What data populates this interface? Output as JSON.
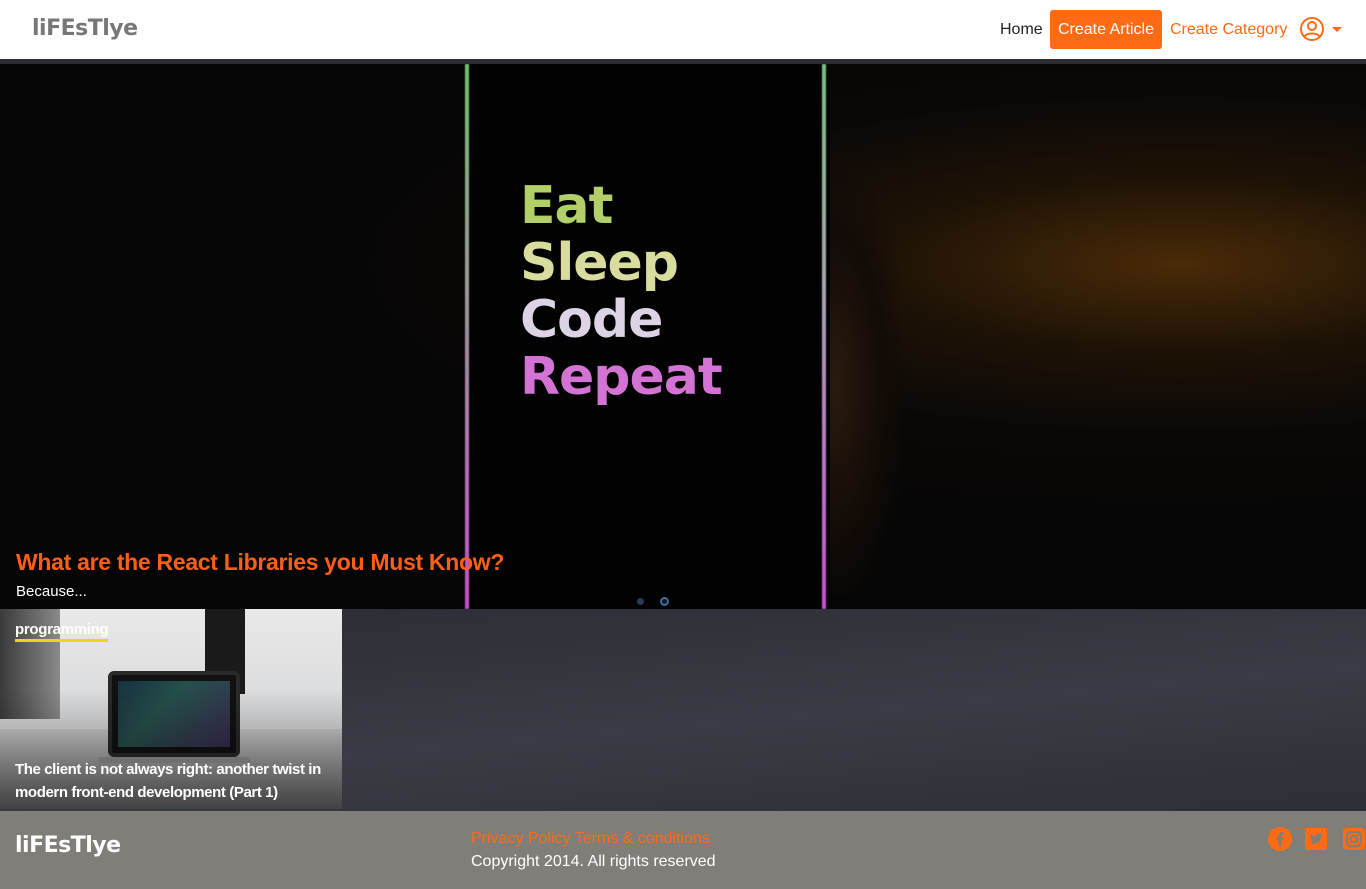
{
  "navbar": {
    "brand": "liFEsTlye",
    "home": "Home",
    "create_article": "Create Article",
    "create_category": "Create Category",
    "user_icon": "user-circle-icon",
    "dropdown_icon": "caret-down-icon"
  },
  "hero": {
    "image_text": [
      "Eat",
      "Sleep",
      "Code",
      "Repeat"
    ],
    "title": "What are the React Libraries you Must Know?",
    "subtitle": "Because..."
  },
  "card": {
    "category": "programming",
    "title": "The client is not always right: another twist in modern front-end development (Part 1)"
  },
  "footer": {
    "brand": "liFEsTlye",
    "privacy": "Privacy Policy",
    "terms": "Terms & conditions",
    "copyright": "Copyright 2014. All rights reserved",
    "social": [
      "facebook-icon",
      "twitter-icon",
      "instagram-icon"
    ]
  },
  "colors": {
    "accent": "#ff6a14",
    "hero_title": "#ff5f15",
    "category_underline": "#e8d81a",
    "footer_bg": "#807e78"
  }
}
